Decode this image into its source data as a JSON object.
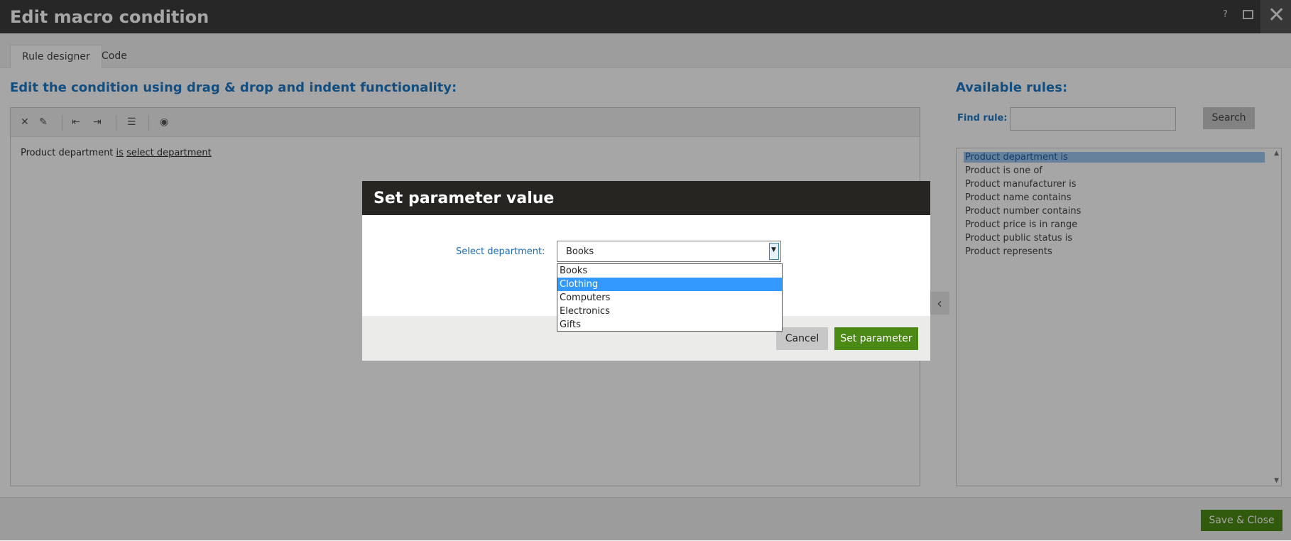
{
  "window": {
    "title": "Edit macro condition",
    "help": "?",
    "maximize": "□",
    "close": "✕"
  },
  "tabs": [
    {
      "label": "Rule designer",
      "active": true
    },
    {
      "label": "Code",
      "active": false
    }
  ],
  "editor": {
    "heading": "Edit the condition using drag & drop and indent functionality:",
    "toolbar": [
      "delete-icon",
      "clear-icon",
      "outdent-icon",
      "indent-icon",
      "indent-group-icon",
      "preview-icon"
    ],
    "condition": {
      "prefix": "Product department",
      "operator": "is",
      "param": "select department"
    }
  },
  "rules_panel": {
    "heading": "Available rules:",
    "find_label": "Find rule:",
    "find_value": "",
    "search_label": "Search",
    "rules": [
      "Product department is",
      "Product is one of",
      "Product manufacturer is",
      "Product name contains",
      "Product number contains",
      "Product price is in range",
      "Product public status is",
      "Product represents"
    ],
    "selected_index": 0
  },
  "footer": {
    "save_close_label": "Save & Close"
  },
  "modal": {
    "title": "Set parameter value",
    "field_label": "Select department:",
    "selected_value": "Books",
    "options": [
      "Books",
      "Clothing",
      "Computers",
      "Electronics",
      "Gifts"
    ],
    "highlighted_index": 1,
    "cancel_label": "Cancel",
    "set_label": "Set parameter"
  },
  "colors": {
    "accent_blue": "#1e79c7",
    "primary_green": "#4a8a14",
    "modal_header": "#262522",
    "option_highlight": "#3399ff"
  }
}
